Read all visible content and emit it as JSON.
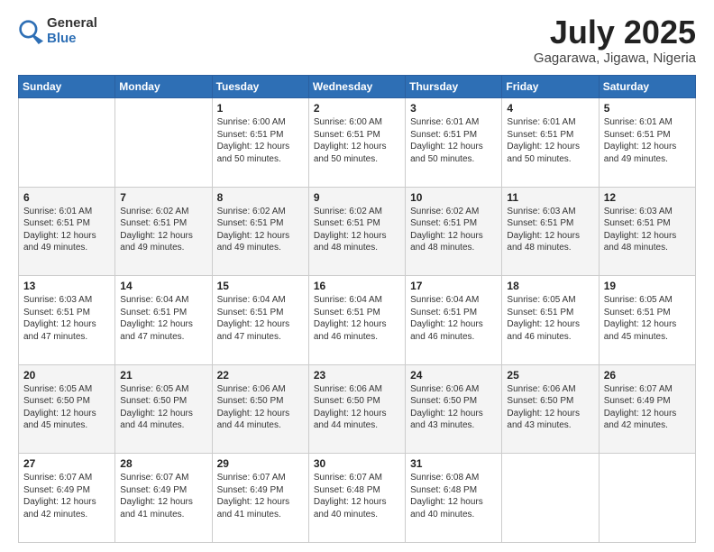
{
  "header": {
    "logo_general": "General",
    "logo_blue": "Blue",
    "month_year": "July 2025",
    "location": "Gagarawa, Jigawa, Nigeria"
  },
  "weekdays": [
    "Sunday",
    "Monday",
    "Tuesday",
    "Wednesday",
    "Thursday",
    "Friday",
    "Saturday"
  ],
  "weeks": [
    [
      {
        "day": "",
        "info": ""
      },
      {
        "day": "",
        "info": ""
      },
      {
        "day": "1",
        "info": "Sunrise: 6:00 AM\nSunset: 6:51 PM\nDaylight: 12 hours\nand 50 minutes."
      },
      {
        "day": "2",
        "info": "Sunrise: 6:00 AM\nSunset: 6:51 PM\nDaylight: 12 hours\nand 50 minutes."
      },
      {
        "day": "3",
        "info": "Sunrise: 6:01 AM\nSunset: 6:51 PM\nDaylight: 12 hours\nand 50 minutes."
      },
      {
        "day": "4",
        "info": "Sunrise: 6:01 AM\nSunset: 6:51 PM\nDaylight: 12 hours\nand 50 minutes."
      },
      {
        "day": "5",
        "info": "Sunrise: 6:01 AM\nSunset: 6:51 PM\nDaylight: 12 hours\nand 49 minutes."
      }
    ],
    [
      {
        "day": "6",
        "info": "Sunrise: 6:01 AM\nSunset: 6:51 PM\nDaylight: 12 hours\nand 49 minutes."
      },
      {
        "day": "7",
        "info": "Sunrise: 6:02 AM\nSunset: 6:51 PM\nDaylight: 12 hours\nand 49 minutes."
      },
      {
        "day": "8",
        "info": "Sunrise: 6:02 AM\nSunset: 6:51 PM\nDaylight: 12 hours\nand 49 minutes."
      },
      {
        "day": "9",
        "info": "Sunrise: 6:02 AM\nSunset: 6:51 PM\nDaylight: 12 hours\nand 48 minutes."
      },
      {
        "day": "10",
        "info": "Sunrise: 6:02 AM\nSunset: 6:51 PM\nDaylight: 12 hours\nand 48 minutes."
      },
      {
        "day": "11",
        "info": "Sunrise: 6:03 AM\nSunset: 6:51 PM\nDaylight: 12 hours\nand 48 minutes."
      },
      {
        "day": "12",
        "info": "Sunrise: 6:03 AM\nSunset: 6:51 PM\nDaylight: 12 hours\nand 48 minutes."
      }
    ],
    [
      {
        "day": "13",
        "info": "Sunrise: 6:03 AM\nSunset: 6:51 PM\nDaylight: 12 hours\nand 47 minutes."
      },
      {
        "day": "14",
        "info": "Sunrise: 6:04 AM\nSunset: 6:51 PM\nDaylight: 12 hours\nand 47 minutes."
      },
      {
        "day": "15",
        "info": "Sunrise: 6:04 AM\nSunset: 6:51 PM\nDaylight: 12 hours\nand 47 minutes."
      },
      {
        "day": "16",
        "info": "Sunrise: 6:04 AM\nSunset: 6:51 PM\nDaylight: 12 hours\nand 46 minutes."
      },
      {
        "day": "17",
        "info": "Sunrise: 6:04 AM\nSunset: 6:51 PM\nDaylight: 12 hours\nand 46 minutes."
      },
      {
        "day": "18",
        "info": "Sunrise: 6:05 AM\nSunset: 6:51 PM\nDaylight: 12 hours\nand 46 minutes."
      },
      {
        "day": "19",
        "info": "Sunrise: 6:05 AM\nSunset: 6:51 PM\nDaylight: 12 hours\nand 45 minutes."
      }
    ],
    [
      {
        "day": "20",
        "info": "Sunrise: 6:05 AM\nSunset: 6:50 PM\nDaylight: 12 hours\nand 45 minutes."
      },
      {
        "day": "21",
        "info": "Sunrise: 6:05 AM\nSunset: 6:50 PM\nDaylight: 12 hours\nand 44 minutes."
      },
      {
        "day": "22",
        "info": "Sunrise: 6:06 AM\nSunset: 6:50 PM\nDaylight: 12 hours\nand 44 minutes."
      },
      {
        "day": "23",
        "info": "Sunrise: 6:06 AM\nSunset: 6:50 PM\nDaylight: 12 hours\nand 44 minutes."
      },
      {
        "day": "24",
        "info": "Sunrise: 6:06 AM\nSunset: 6:50 PM\nDaylight: 12 hours\nand 43 minutes."
      },
      {
        "day": "25",
        "info": "Sunrise: 6:06 AM\nSunset: 6:50 PM\nDaylight: 12 hours\nand 43 minutes."
      },
      {
        "day": "26",
        "info": "Sunrise: 6:07 AM\nSunset: 6:49 PM\nDaylight: 12 hours\nand 42 minutes."
      }
    ],
    [
      {
        "day": "27",
        "info": "Sunrise: 6:07 AM\nSunset: 6:49 PM\nDaylight: 12 hours\nand 42 minutes."
      },
      {
        "day": "28",
        "info": "Sunrise: 6:07 AM\nSunset: 6:49 PM\nDaylight: 12 hours\nand 41 minutes."
      },
      {
        "day": "29",
        "info": "Sunrise: 6:07 AM\nSunset: 6:49 PM\nDaylight: 12 hours\nand 41 minutes."
      },
      {
        "day": "30",
        "info": "Sunrise: 6:07 AM\nSunset: 6:48 PM\nDaylight: 12 hours\nand 40 minutes."
      },
      {
        "day": "31",
        "info": "Sunrise: 6:08 AM\nSunset: 6:48 PM\nDaylight: 12 hours\nand 40 minutes."
      },
      {
        "day": "",
        "info": ""
      },
      {
        "day": "",
        "info": ""
      }
    ]
  ]
}
